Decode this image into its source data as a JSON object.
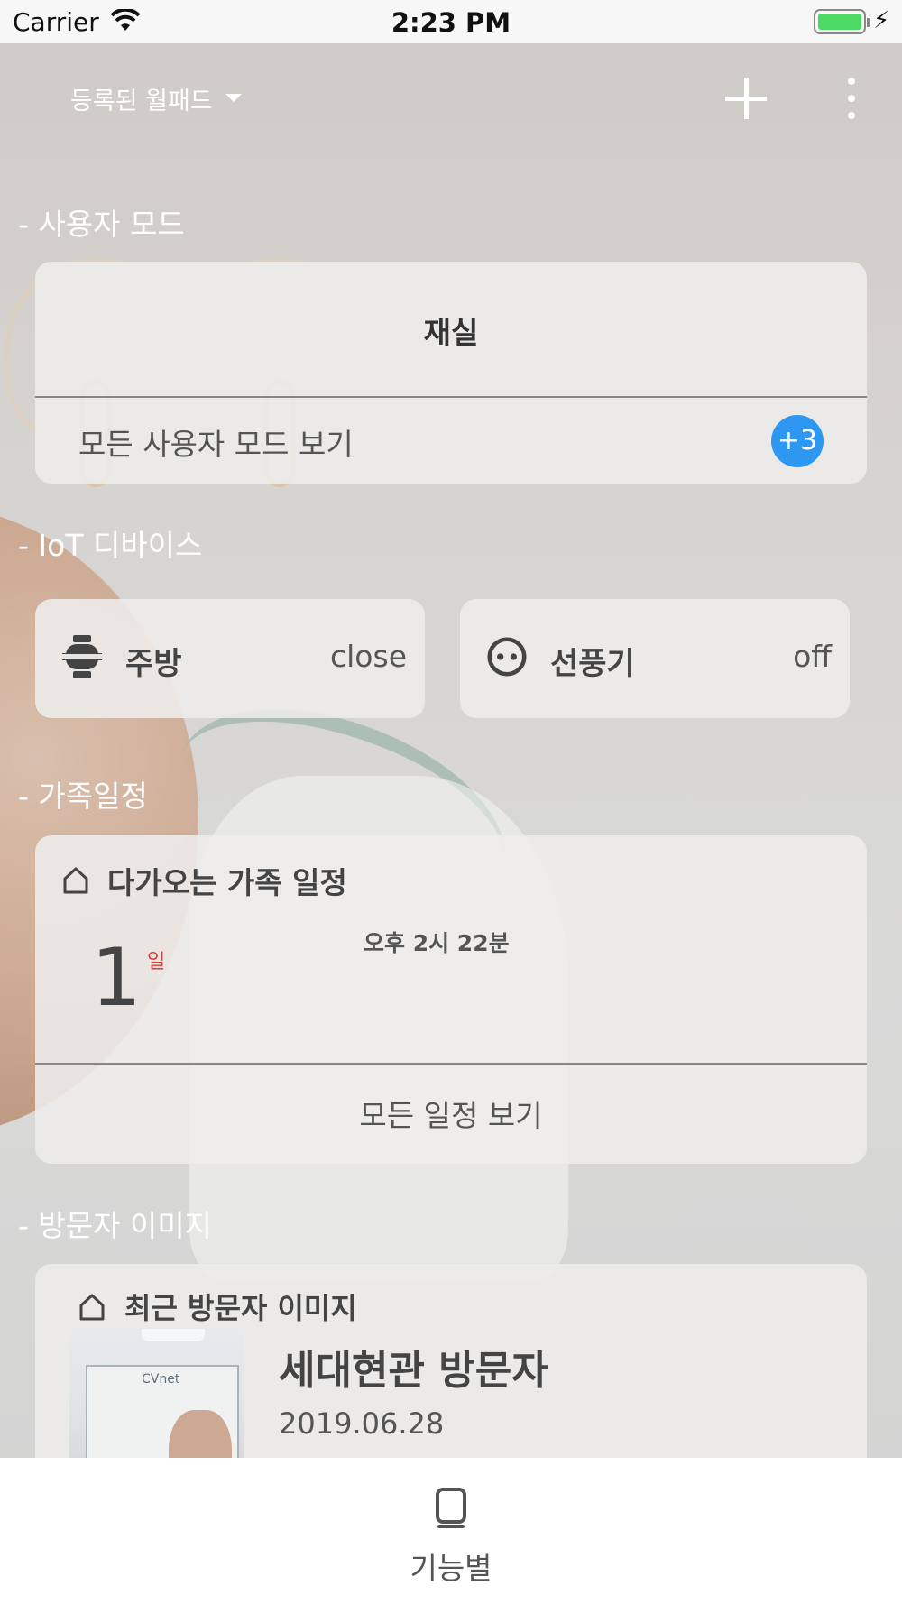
{
  "status_bar": {
    "carrier": "Carrier",
    "time": "2:23 PM",
    "battery_color": "#4cd964"
  },
  "header": {
    "title": "등록된 월패드",
    "add_icon": "plus-icon",
    "more_icon": "more-vertical-icon"
  },
  "sections": {
    "user_mode": "- 사용자 모드",
    "iot": "- IoT 디바이스",
    "family": "- 가족일정",
    "visitor": "- 방문자 이미지"
  },
  "user_mode": {
    "current": "재실",
    "view_all": "모든 사용자 모드 보기",
    "extra_count": "+3",
    "badge_color": "#2e97f2"
  },
  "iot_devices": [
    {
      "name": "주방",
      "state": "close",
      "icon": "gas-valve-icon"
    },
    {
      "name": "선풍기",
      "state": "off",
      "icon": "outlet-icon"
    }
  ],
  "family_schedule": {
    "heading": "다가오는 가족 일정",
    "time": "오후 2시 22분",
    "day": "1",
    "day_unit": "일",
    "day_unit_color": "#e03a3a",
    "view_all": "모든 일정 보기"
  },
  "visitor": {
    "heading": "최근 방문자 이미지",
    "title": "세대현관 방문자",
    "date": "2019.06.28",
    "thumb_logo": "CVnet"
  },
  "tabbar": {
    "label": "기능별",
    "icon": "phone-icon"
  }
}
